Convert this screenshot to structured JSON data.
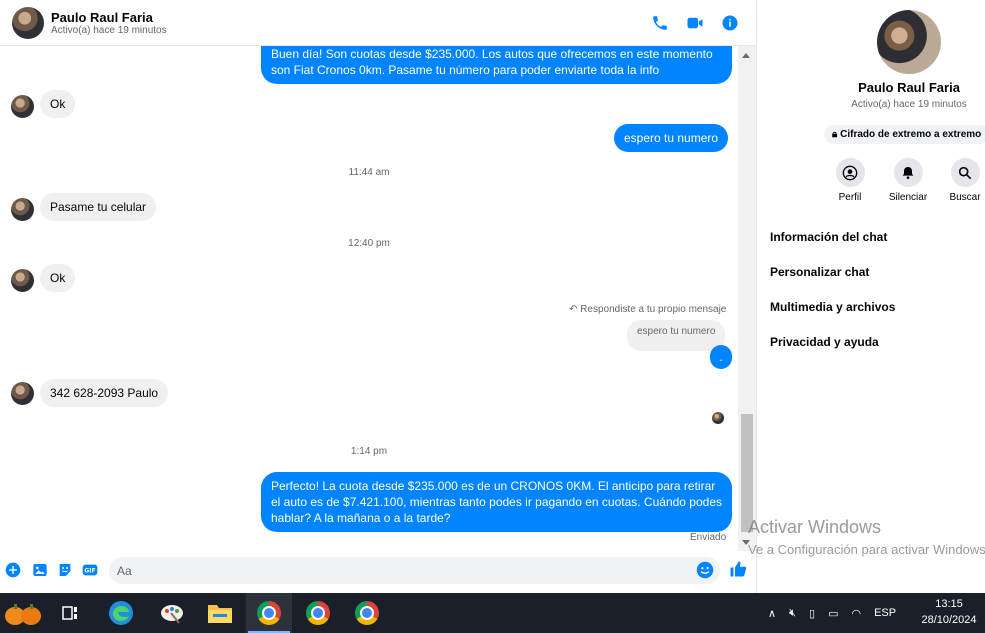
{
  "header": {
    "name": "Paulo Raul Faria",
    "status": "Activo(a) hace 19 minutos",
    "icons": [
      "phone-icon",
      "video-icon",
      "info-icon"
    ],
    "accent": "#0084ff"
  },
  "messages": {
    "out_first": "Buen día! Son cuotas desde $235.000. Los autos que ofrecemos en este momento son Fiat Cronos 0km. Pasame tu número para poder enviarte toda la info",
    "in_ok_1": "Ok",
    "out_espero": "espero tu numero",
    "time_1": "11:44 am",
    "in_celular": "Pasame tu celular",
    "time_2": "12:40 pm",
    "in_ok_2": "Ok",
    "replied_note": "Respondiste a tu propio mensaje",
    "quoted": "espero tu numero",
    "out_dot": ".",
    "in_number": "342 628-2093 Paulo",
    "time_3": "1:14 pm",
    "out_last": "Perfecto! La cuota desde $235.000 es de un CRONOS 0KM. El anticipo para retirar el auto es de $7.421.100, mientras tanto podes ir pagando en cuotas. Cuándo podes hablar? A la mañana o a la tarde?",
    "sent_label": "Enviado"
  },
  "composer": {
    "placeholder": "Aa",
    "value": "",
    "icons": [
      "plus-icon",
      "image-icon",
      "sticker-icon",
      "gif-icon",
      "emoji-icon",
      "like-icon"
    ]
  },
  "panel": {
    "name": "Paulo Raul Faria",
    "status": "Activo(a) hace 19 minutos",
    "encryption": "Cifrado de extremo a extremo",
    "actions": [
      {
        "label": "Perfil",
        "icon": "profile-icon"
      },
      {
        "label": "Silenciar",
        "icon": "bell-icon"
      },
      {
        "label": "Buscar",
        "icon": "search-icon"
      }
    ],
    "menu": [
      "Información del chat",
      "Personalizar chat",
      "Multimedia y archivos",
      "Privacidad y ayuda"
    ]
  },
  "watermark": {
    "title": "Activar Windows",
    "subtitle": "Ve a Configuración para activar Windows."
  },
  "taskbar": {
    "language": "ESP",
    "time": "13:15",
    "date": "28/10/2024",
    "bg": "#1a1f2a"
  }
}
